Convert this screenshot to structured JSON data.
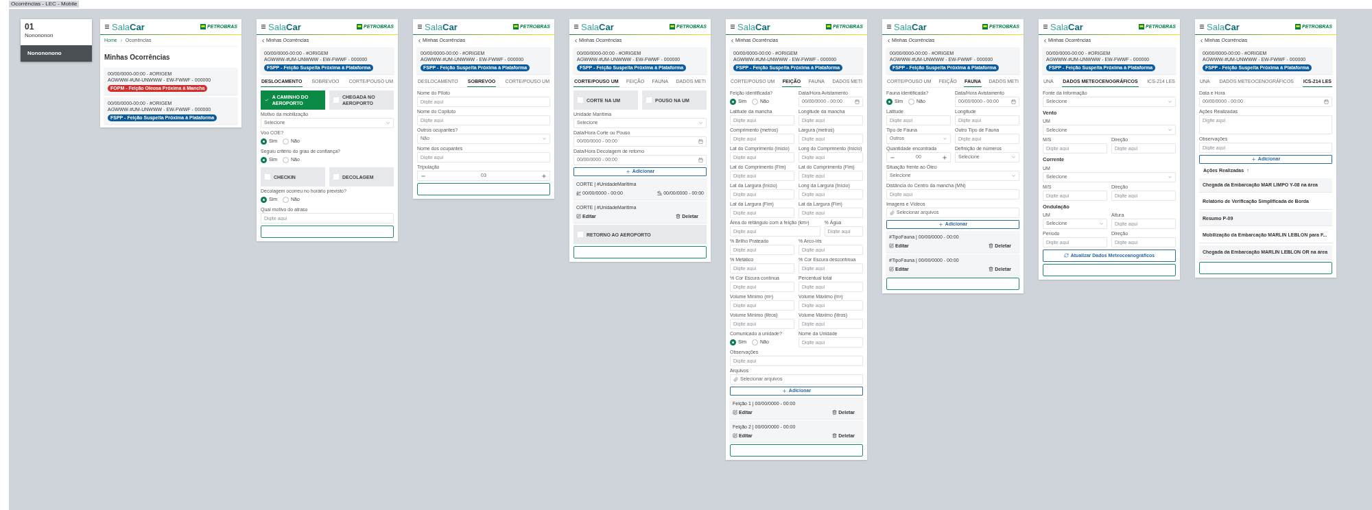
{
  "canvas_label": "Ocorrências - LEC - Mobile",
  "frames": [
    {
      "kind": "menu",
      "number": "01",
      "subtitle": "Nonononon",
      "items": [
        {
          "label": "Nonononono",
          "selected": true
        }
      ]
    },
    {
      "kind": "screen",
      "logo_a": "Sala",
      "logo_b": "Car",
      "brand": "PETROBRAS",
      "breadcrumb": [
        "Home",
        "Ocorrências"
      ],
      "title": "Minhas Ocorrências",
      "cards": [
        {
          "line1": "00/00/0000-00:00 - #ORIGEM",
          "line2": "AGWWW-#UM-UNWWW - EW-FWWF - 000000",
          "tag": {
            "text": "FOPM - Feição Oleosa Próxima à Mancha",
            "color": "#d32f2f"
          }
        },
        {
          "line1": "00/00/0000-00:00 - #ORIGEM",
          "line2": "AGWWW-#UM-UNWWW - EW-FWWF - 000000",
          "tag": {
            "text": "FSPP - Feição Suspeita Próxima à Plataforma",
            "color": "#0a5a9c"
          }
        }
      ]
    },
    {
      "kind": "screen",
      "logo_a": "Sala",
      "logo_b": "Car",
      "brand": "PETROBRAS",
      "back": "Minhas Ocorrências",
      "cards": [
        {
          "line1": "00/00/0000-00:00 - #ORIGEM",
          "line2": "AGWWW-#UM-UNWWW - EW-FWWF - 000000",
          "tag": {
            "text": "FSPP - Feição Suspeita Próxima à Plataforma",
            "color": "#0a5a9c"
          }
        }
      ],
      "tabs": [
        {
          "label": "DESLOCAMENTO",
          "selected": true
        },
        {
          "label": "SOBREVOO",
          "selected": false
        },
        {
          "label": "CORTE/POUSO UM",
          "selected": false
        }
      ],
      "blocks": [
        {
          "kind": "toggles",
          "items": [
            {
              "label": "A CAMINHO DO AEROPORTO",
              "checked": true
            },
            {
              "label": "CHEGADA NO AEROPORTO",
              "checked": false
            }
          ]
        },
        {
          "kind": "select",
          "label": "Motivo da mobilização",
          "value": "Selecione"
        },
        {
          "kind": "radio",
          "label": "Voo COE?",
          "options": [
            {
              "label": "Sim",
              "selected": true
            },
            {
              "label": "Não",
              "selected": false
            }
          ]
        },
        {
          "kind": "radio",
          "label": "Seguiu critério do grau de confiança?",
          "options": [
            {
              "label": "Sim",
              "selected": true
            },
            {
              "label": "Não",
              "selected": false
            }
          ]
        },
        {
          "kind": "toggles",
          "items": [
            {
              "label": "CHECKIN",
              "checked": false
            },
            {
              "label": "DECOLAGEM",
              "checked": false
            }
          ]
        },
        {
          "kind": "radio",
          "label": "Decolagem ocorreu no horário previsto?",
          "options": [
            {
              "label": "Sim",
              "selected": true
            },
            {
              "label": "Não",
              "selected": false
            }
          ]
        },
        {
          "kind": "input",
          "label": "Qual motivo do atraso",
          "placeholder": "Digite aqui"
        },
        {
          "kind": "submit"
        }
      ]
    },
    {
      "kind": "screen",
      "logo_a": "Sala",
      "logo_b": "Car",
      "brand": "PETROBRAS",
      "back": "Minhas Ocorrências",
      "cards": [
        {
          "line1": "00/00/0000-00:00 - #ORIGEM",
          "line2": "AGWWW-#UM-UNWWW - EW-FWWF - 000000",
          "tag": {
            "text": "FSPP - Feição Suspeita Próxima à Plataforma",
            "color": "#0a5a9c"
          }
        }
      ],
      "tabs": [
        {
          "label": "DESLOCAMENTO",
          "selected": false
        },
        {
          "label": "SOBREVOO",
          "selected": true
        },
        {
          "label": "CORTE/POUSO UM",
          "selected": false
        }
      ],
      "blocks": [
        {
          "kind": "input",
          "label": "Nome do Piloto",
          "placeholder": "Digite aqui"
        },
        {
          "kind": "input",
          "label": "Nome do Copiloto",
          "placeholder": "Digite aqui"
        },
        {
          "kind": "select",
          "label": "Outros ocupantes?",
          "value": "Não"
        },
        {
          "kind": "input",
          "label": "Nome dos ocupantes",
          "placeholder": "Digite aqui"
        },
        {
          "kind": "stepper",
          "label": "Tripulação",
          "value": "03"
        },
        {
          "kind": "submit"
        }
      ]
    },
    {
      "kind": "screen",
      "logo_a": "Sala",
      "logo_b": "Car",
      "brand": "PETROBRAS",
      "back": "Minhas Ocorrências",
      "cards": [
        {
          "line1": "00/00/0000-00:00 - #ORIGEM",
          "line2": "AGWWW-#UM-UNWWW - EW-FWWF - 000000",
          "tag": {
            "text": "FSPP - Feição Suspeita Próxima à Plataforma",
            "color": "#0a5a9c"
          }
        }
      ],
      "tabs": [
        {
          "label": "CORTE/POUSO UM",
          "selected": true
        },
        {
          "label": "FEIÇÃO",
          "selected": false
        },
        {
          "label": "FAUNA",
          "selected": false
        },
        {
          "label": "DADOS METI",
          "selected": false
        }
      ],
      "blocks": [
        {
          "kind": "toggles",
          "items": [
            {
              "label": "CORTE NA UM",
              "checked": false
            },
            {
              "label": "POUSO NA UM",
              "checked": false
            }
          ]
        },
        {
          "kind": "select",
          "label": "Unidade Marítima",
          "value": "Selecione"
        },
        {
          "kind": "date",
          "label": "Data/Hora Corte ou Pouso",
          "value": "00/00/0000 - 00:00"
        },
        {
          "kind": "date",
          "label": "Data/Hora Decolagem de retorno",
          "value": "00/00/0000 - 00:00"
        },
        {
          "kind": "add",
          "label": "Adicionar"
        },
        {
          "kind": "record",
          "title": "CORTE | #UnidadeMarítima",
          "dates": [
            "00/00/0000 - 00:00",
            "00/00/0000 - 00:00"
          ]
        },
        {
          "kind": "record",
          "title": "CORTE | #UnidadeMarítima",
          "actions": [
            "Editar",
            "Deletar"
          ]
        },
        {
          "kind": "toggle",
          "label": "RETORNO AO AEROPORTO",
          "checked": false
        },
        {
          "kind": "submit"
        }
      ]
    },
    {
      "kind": "screen",
      "logo_a": "Sala",
      "logo_b": "Car",
      "brand": "PETROBRAS",
      "back": "Minhas Ocorrências",
      "cards": [
        {
          "line1": "00/00/0000-00:00 - #ORIGEM",
          "line2": "AGWWW-#UM-UNWWW - EW-FWWF - 000000",
          "tag": {
            "text": "FSPP - Feição Suspeita Próxima à Plataforma",
            "color": "#0a5a9c"
          }
        }
      ],
      "tabs": [
        {
          "label": "CORTE/POUSO UM",
          "selected": false
        },
        {
          "label": "FEIÇÃO",
          "selected": true
        },
        {
          "label": "FAUNA",
          "selected": false
        },
        {
          "label": "DADOS METI",
          "selected": false
        }
      ],
      "blocks": [
        {
          "kind": "row",
          "cells": [
            {
              "kind": "radio",
              "label": "Feição identificada?",
              "options": [
                {
                  "label": "Sim",
                  "selected": true
                },
                {
                  "label": "Não",
                  "selected": false
                }
              ]
            },
            {
              "kind": "date",
              "label": "Data/Hora Avistamento",
              "value": "00/00/0000 - 00:00"
            }
          ]
        },
        {
          "kind": "row",
          "cells": [
            {
              "kind": "input",
              "label": "Latitude da mancha",
              "placeholder": "Digite aqui"
            },
            {
              "kind": "input",
              "label": "Longitude da mancha",
              "placeholder": "Digite aqui"
            }
          ]
        },
        {
          "kind": "row",
          "cells": [
            {
              "kind": "input",
              "label": "Comprimento (metros)",
              "placeholder": "Digite aqui"
            },
            {
              "kind": "input",
              "label": "Largura (metros)",
              "placeholder": "Digite aqui"
            }
          ]
        },
        {
          "kind": "row",
          "cells": [
            {
              "kind": "input",
              "label": "Lat do Comprimento (Início)",
              "placeholder": "Digite aqui"
            },
            {
              "kind": "input",
              "label": "Long do Comprimento (Início)",
              "placeholder": "Digite aqui"
            }
          ]
        },
        {
          "kind": "row",
          "cells": [
            {
              "kind": "input",
              "label": "Lat do Comprimento (Fim)",
              "placeholder": "Digite aqui"
            },
            {
              "kind": "input",
              "label": "Lat do Comprimento (Fim)",
              "placeholder": "Digite aqui"
            }
          ]
        },
        {
          "kind": "row",
          "cells": [
            {
              "kind": "input",
              "label": "Lat da Largura (Início)",
              "placeholder": "Digite aqui"
            },
            {
              "kind": "input",
              "label": "Long da Largura (Início)",
              "placeholder": "Digite aqui"
            }
          ]
        },
        {
          "kind": "row",
          "cells": [
            {
              "kind": "input",
              "label": "Lat da Largura (Fim)",
              "placeholder": "Digite aqui"
            },
            {
              "kind": "input",
              "label": "Lat da Largura (Fim)",
              "placeholder": "Digite aqui"
            }
          ]
        },
        {
          "kind": "row",
          "wide": true,
          "cells": [
            {
              "kind": "input",
              "label": "Área do retângulo com a feição (km²)",
              "placeholder": "Digite aqui"
            },
            {
              "kind": "input",
              "label": "% Água",
              "placeholder": "Digite aqui"
            }
          ]
        },
        {
          "kind": "row",
          "cells": [
            {
              "kind": "input",
              "label": "% Brilho Prateado",
              "placeholder": "Digite aqui"
            },
            {
              "kind": "input",
              "label": "% Arco-íris",
              "placeholder": "Digite aqui"
            }
          ]
        },
        {
          "kind": "row",
          "cells": [
            {
              "kind": "input",
              "label": "% Metálico",
              "placeholder": "Digite aqui"
            },
            {
              "kind": "input",
              "label": "% Cor Escura descontínua",
              "placeholder": "Digite aqui"
            }
          ]
        },
        {
          "kind": "row",
          "cells": [
            {
              "kind": "input",
              "label": "% Cor Escura contínua",
              "placeholder": "Digite aqui"
            },
            {
              "kind": "input",
              "label": "Percentual total",
              "placeholder": "Digite aqui"
            }
          ]
        },
        {
          "kind": "row",
          "cells": [
            {
              "kind": "input",
              "label": "Volume Mínimo (m³)",
              "placeholder": "Digite aqui"
            },
            {
              "kind": "input",
              "label": "Volume Máximo (m³)",
              "placeholder": "Digite aqui"
            }
          ]
        },
        {
          "kind": "row",
          "cells": [
            {
              "kind": "input",
              "label": "Volume Mínimo (litros)",
              "placeholder": "Digite aqui"
            },
            {
              "kind": "input",
              "label": "Volume Máximo (litros)",
              "placeholder": "Digite aqui"
            }
          ]
        },
        {
          "kind": "row",
          "cells": [
            {
              "kind": "radio",
              "label": "Comunicado a unidade?",
              "options": [
                {
                  "label": "Sim",
                  "selected": true
                },
                {
                  "label": "Não",
                  "selected": false
                }
              ]
            },
            {
              "kind": "input",
              "label": "Nome da Unidade",
              "placeholder": "Digite aqui"
            }
          ]
        },
        {
          "kind": "input",
          "label": "Observações",
          "placeholder": "Digite aqui"
        },
        {
          "kind": "file",
          "label": "Arquivos",
          "placeholder": "Selecionar arquivos"
        },
        {
          "kind": "add",
          "label": "Adicionar"
        },
        {
          "kind": "record",
          "title": "Feição 1 | 00/00/0000 - 00:00",
          "actions": [
            "Editar",
            "Deletar"
          ]
        },
        {
          "kind": "record",
          "title": "Feição 2 | 00/00/0000 - 00:00",
          "actions": [
            "Editar",
            "Deletar"
          ]
        },
        {
          "kind": "submit"
        }
      ]
    },
    {
      "kind": "screen",
      "logo_a": "Sala",
      "logo_b": "Car",
      "brand": "PETROBRAS",
      "back": "Minhas Ocorrências",
      "cards": [
        {
          "line1": "00/00/0000-00:00 - #ORIGEM",
          "line2": "AGWWW-#UM-UNWWW - EW-FWWF - 000000",
          "tag": {
            "text": "FSPP - Feição Suspeita Próxima à Plataforma",
            "color": "#0a5a9c"
          }
        }
      ],
      "tabs": [
        {
          "label": "CORTE/POUSO UM",
          "selected": false
        },
        {
          "label": "FEIÇÃO",
          "selected": false
        },
        {
          "label": "FAUNA",
          "selected": true
        },
        {
          "label": "DADOS METI",
          "selected": false
        }
      ],
      "blocks": [
        {
          "kind": "row",
          "cells": [
            {
              "kind": "radio",
              "label": "Fauna identificada?",
              "options": [
                {
                  "label": "Sim",
                  "selected": true
                },
                {
                  "label": "Não",
                  "selected": false
                }
              ]
            },
            {
              "kind": "date",
              "label": "Data/Hora Avistamento",
              "value": "00/00/0000 - 00:00"
            }
          ]
        },
        {
          "kind": "row",
          "cells": [
            {
              "kind": "input",
              "label": "Latitude",
              "placeholder": "Digite aqui"
            },
            {
              "kind": "input",
              "label": "Longitude",
              "placeholder": "Digite aqui"
            }
          ]
        },
        {
          "kind": "row",
          "cells": [
            {
              "kind": "select",
              "label": "Tipo de Fauna",
              "value": "Outros"
            },
            {
              "kind": "input",
              "label": "Outro Tipo de Fauna",
              "placeholder": "Digite aqui"
            }
          ]
        },
        {
          "kind": "row",
          "cells": [
            {
              "kind": "stepper",
              "label": "Quantidade encontrada",
              "value": "00"
            },
            {
              "kind": "select",
              "label": "Definição de números",
              "value": "Selecione"
            }
          ]
        },
        {
          "kind": "select",
          "label": "Situação frente ao Óleo",
          "value": "Selecione"
        },
        {
          "kind": "input",
          "label": "Distância do Centro da mancha (MN)",
          "placeholder": "Digite aqui"
        },
        {
          "kind": "file",
          "label": "Imagens e Vídeos",
          "placeholder": "Selecionar arquivos"
        },
        {
          "kind": "add",
          "label": "Adicionar"
        },
        {
          "kind": "record",
          "title": "#TipoFauna | 00/00/0000 - 00:00",
          "actions": [
            "Editar",
            "Deletar"
          ]
        },
        {
          "kind": "record",
          "title": "#TipoFauna | 00/00/0000 - 00:00",
          "actions": [
            "Editar",
            "Deletar"
          ]
        },
        {
          "kind": "submit"
        }
      ]
    },
    {
      "kind": "screen",
      "logo_a": "Sala",
      "logo_b": "Car",
      "brand": "PETROBRAS",
      "back": "Minhas Ocorrências",
      "cards": [
        {
          "line1": "00/00/0000-00:00 - #ORIGEM",
          "line2": "AGWWW-#UM-UNWWW - EW-FWWF - 000000",
          "tag": {
            "text": "FSPP - Feição Suspeita Próxima à Plataforma",
            "color": "#0a5a9c"
          }
        }
      ],
      "tabs": [
        {
          "label": "UNA",
          "selected": false
        },
        {
          "label": "DADOS METEOCENOGRÁFICOS",
          "selected": true
        },
        {
          "label": "ICS-214 LES",
          "selected": false
        }
      ],
      "blocks": [
        {
          "kind": "select",
          "label": "Fonte da Informação",
          "value": "Selecione"
        },
        {
          "kind": "section",
          "label": "Vento"
        },
        {
          "kind": "select",
          "label": "UM",
          "value": "Selecione"
        },
        {
          "kind": "row",
          "cells": [
            {
              "kind": "input",
              "label": "M/S",
              "placeholder": "Digite aqui"
            },
            {
              "kind": "input",
              "label": "Direção",
              "placeholder": "Digite aqui"
            }
          ]
        },
        {
          "kind": "section",
          "label": "Corrente"
        },
        {
          "kind": "select",
          "label": "UM",
          "value": "Selecione"
        },
        {
          "kind": "row",
          "cells": [
            {
              "kind": "input",
              "label": "M/S",
              "placeholder": "Digite aqui"
            },
            {
              "kind": "input",
              "label": "Direção",
              "placeholder": "Digite aqui"
            }
          ]
        },
        {
          "kind": "section",
          "label": "Ondulação"
        },
        {
          "kind": "row",
          "cells": [
            {
              "kind": "select",
              "label": "UM",
              "value": "Selecione"
            },
            {
              "kind": "input",
              "label": "Altura",
              "placeholder": "Digite aqui"
            }
          ]
        },
        {
          "kind": "row",
          "cells": [
            {
              "kind": "input",
              "label": "Período",
              "placeholder": "Digite aqui"
            },
            {
              "kind": "input",
              "label": "Direção",
              "placeholder": "Digite aqui"
            }
          ]
        },
        {
          "kind": "refresh",
          "label": "Atualizar Dados Meteoceanográficos"
        },
        {
          "kind": "submit"
        }
      ]
    },
    {
      "kind": "screen",
      "logo_a": "Sala",
      "logo_b": "Car",
      "brand": "PETROBRAS",
      "back": "Minhas Ocorrências",
      "cards": [
        {
          "line1": "00/00/0000-00:00 - #ORIGEM",
          "line2": "AGWWW-#UM-UNWWW - EW-FWWF - 000000",
          "tag": {
            "text": "FSPP - Feição Suspeita Próxima à Plataforma",
            "color": "#0a5a9c"
          }
        }
      ],
      "tabs": [
        {
          "label": "UNA",
          "selected": false
        },
        {
          "label": "DADOS METEOCENOGRÁFICOS",
          "selected": false
        },
        {
          "label": "ICS-214 LES",
          "selected": true
        }
      ],
      "blocks": [
        {
          "kind": "date",
          "label": "Data e Hora",
          "value": "00/00/0000 - 00:00"
        },
        {
          "kind": "textarea",
          "label": "Ações Realizadas",
          "placeholder": "Digite aqui"
        },
        {
          "kind": "input",
          "label": "Observações",
          "placeholder": "Digite aqui"
        },
        {
          "kind": "add",
          "label": "Adicionar"
        },
        {
          "kind": "list_header",
          "label": "Ações Realizadas",
          "arrow": "↑"
        },
        {
          "kind": "list_item",
          "label": "Chegada da Embarcação MAR LIMPO Y-08 na área"
        },
        {
          "kind": "list_item",
          "label": "Relatório de Verificação Simplificada de Borda"
        },
        {
          "kind": "list_item",
          "label": "Resumo P-09"
        },
        {
          "kind": "list_item",
          "label": "Mobilização da Embarcação MARLIN LEBLON para F..."
        },
        {
          "kind": "list_item",
          "label": "Chegada da Embarcação MARLIN LEBLON OR na área"
        },
        {
          "kind": "submit"
        }
      ]
    }
  ]
}
